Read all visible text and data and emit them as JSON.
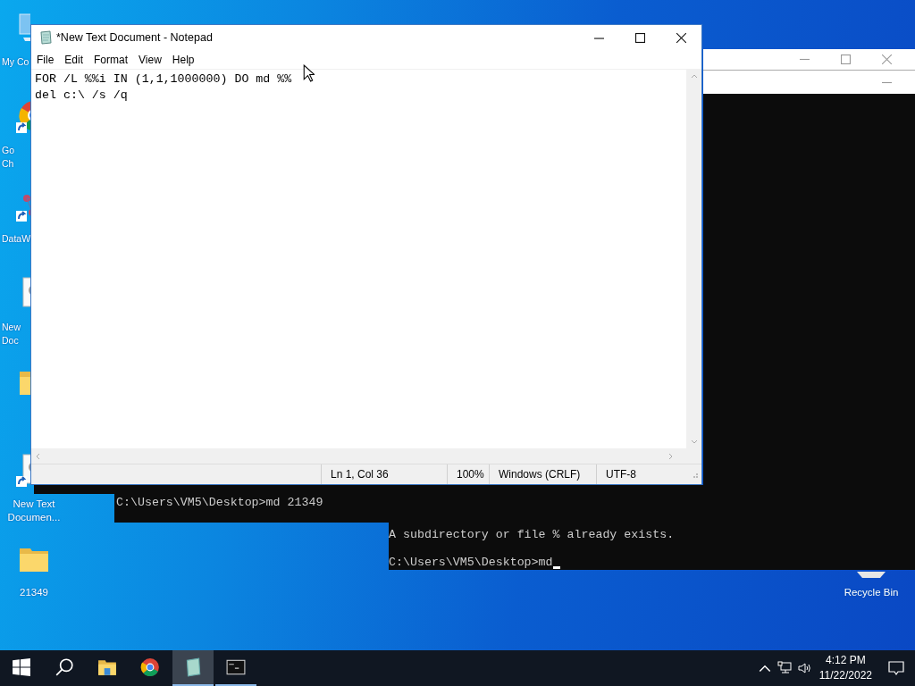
{
  "desktop_icons": [
    {
      "kind": "computer",
      "lines": [
        "My Co"
      ],
      "clipped": true,
      "shortcut": false
    },
    {
      "kind": "chrome",
      "lines": [
        "Go",
        "Ch"
      ],
      "clipped": true,
      "shortcut": true
    },
    {
      "kind": "app",
      "lines": [
        "DataW"
      ],
      "clipped": true,
      "shortcut": true
    },
    {
      "kind": "document",
      "lines": [
        "New",
        "Doc"
      ],
      "clipped": true,
      "shortcut": false
    },
    {
      "kind": "folder",
      "clipped": true,
      "shortcut": false
    },
    {
      "kind": "document",
      "lines": [
        "New Text",
        "Documen..."
      ],
      "clipped": false,
      "icon_clipped": true,
      "shortcut": true
    },
    {
      "kind": "folder",
      "lines": [
        "21349"
      ],
      "clipped": false,
      "shortcut": false
    }
  ],
  "recycle_bin": {
    "label": "Recycle Bin"
  },
  "consoles": [
    {
      "paragraphs": [
        "C:\\Users\\VM5\\Desktop>md 21349"
      ]
    },
    {
      "paragraphs": [
        "A subdirectory or file % already exists.",
        "C:\\Users\\VM5\\Desktop>md"
      ],
      "cursor": true
    }
  ],
  "notepad": {
    "title": "*New Text Document - Notepad",
    "menu": [
      "File",
      "Edit",
      "Format",
      "View",
      "Help"
    ],
    "lines": [
      "FOR /L %%i IN (1,1,1000000) DO md %%",
      "del c:\\ /s /q"
    ],
    "status": [
      "Ln 1, Col 36",
      "100%",
      "Windows (CRLF)",
      "UTF-8"
    ]
  },
  "taskbar": {
    "apps": [
      {
        "kind": "start",
        "active": false,
        "running": false
      },
      {
        "kind": "search",
        "active": false,
        "running": false
      },
      {
        "kind": "explorer",
        "active": false,
        "running": false
      },
      {
        "kind": "chrome",
        "active": false,
        "running": false
      },
      {
        "kind": "notepad",
        "active": true,
        "running": true
      },
      {
        "kind": "cmd",
        "active": false,
        "running": true
      }
    ],
    "time": "4:12 PM",
    "date": "11/22/2022"
  }
}
